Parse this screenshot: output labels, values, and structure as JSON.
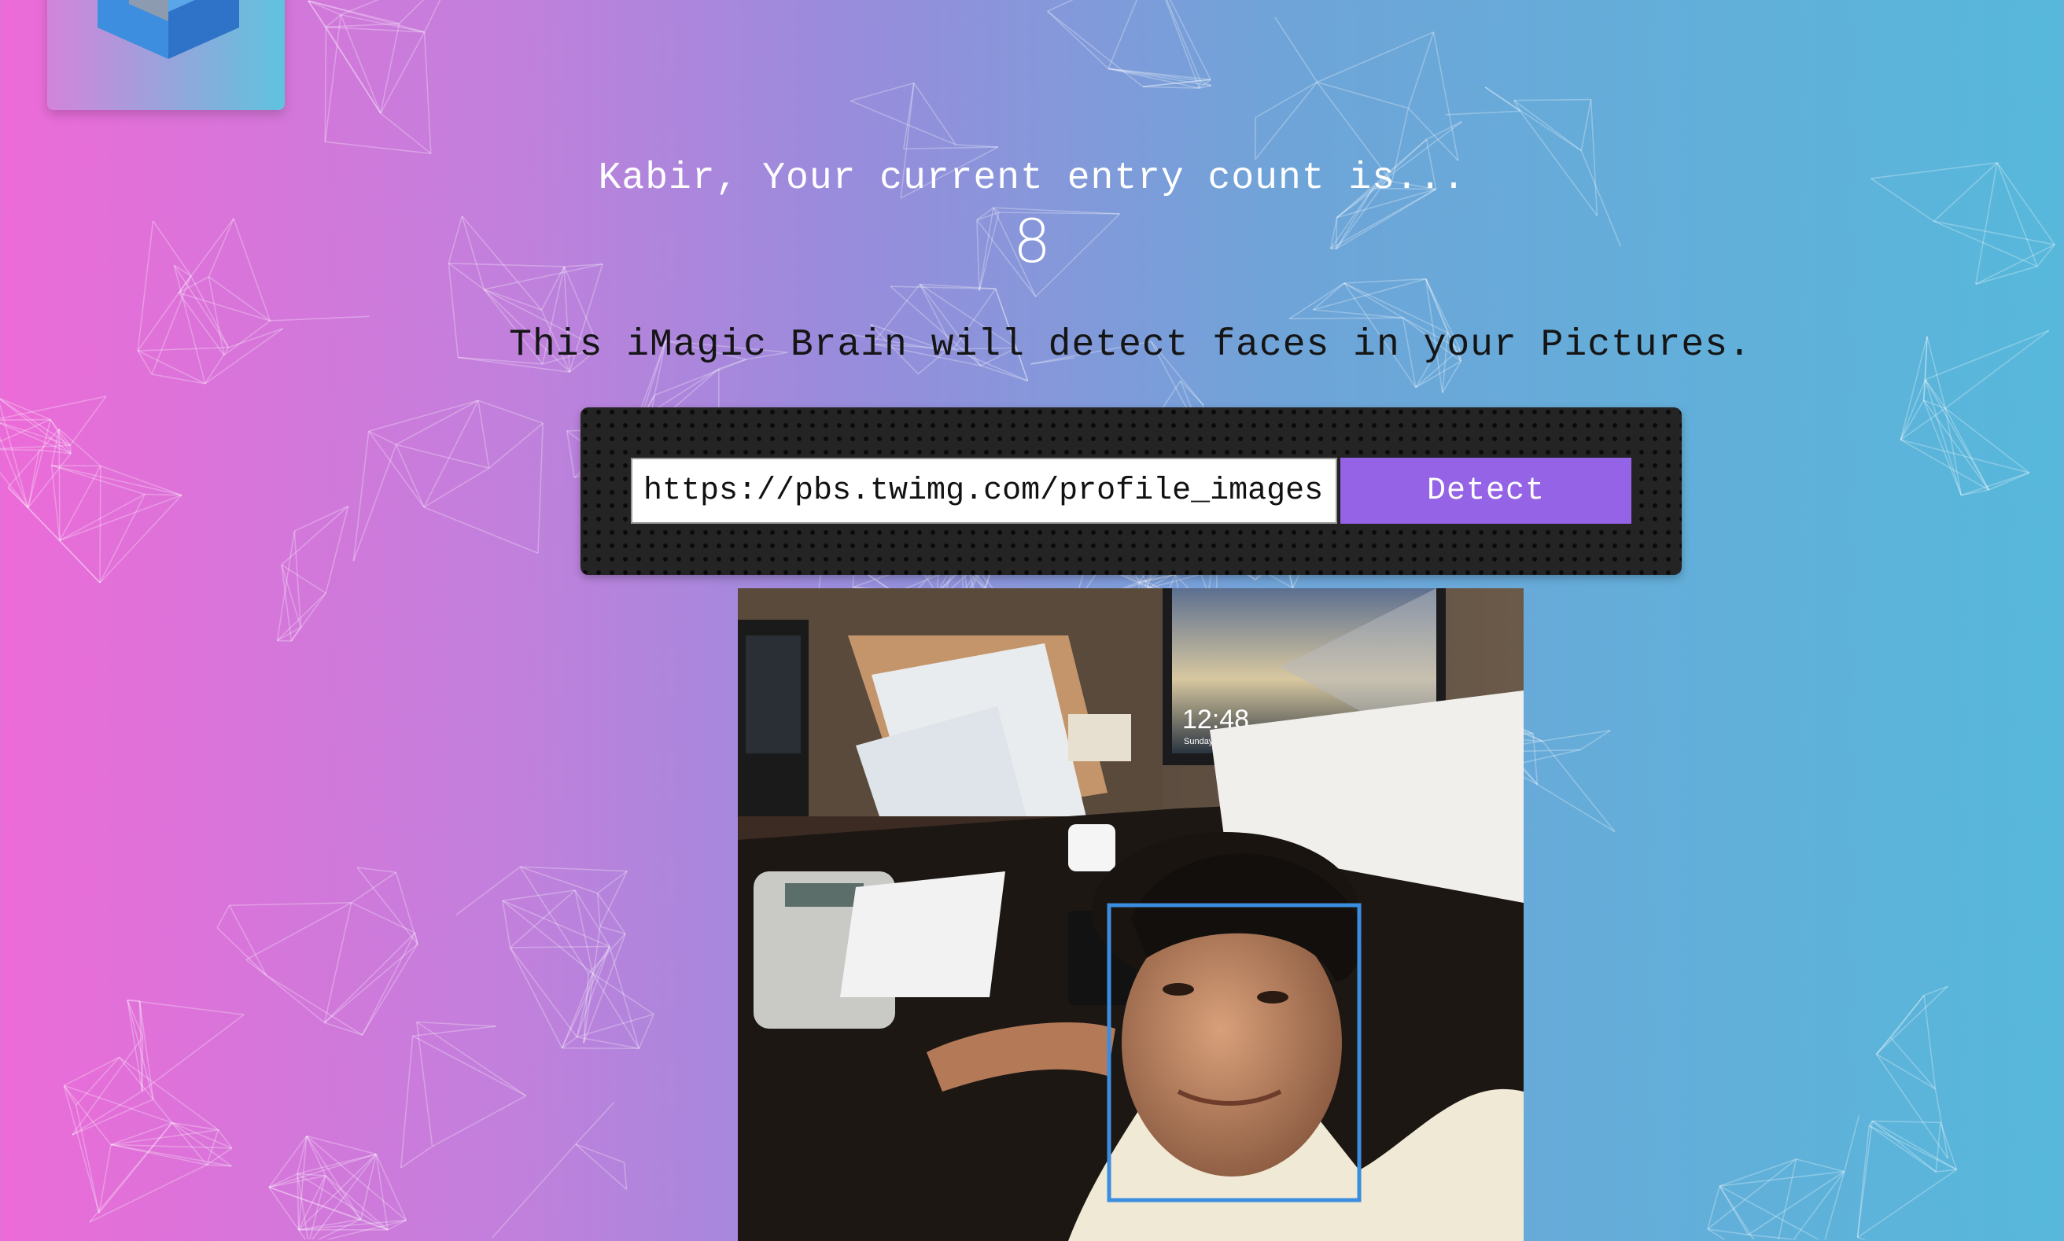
{
  "user": {
    "greeting": "Kabir, Your current entry count is...",
    "entry_count": "8"
  },
  "app": {
    "logo_icon": "cube-logo-icon",
    "tagline": "This iMagic Brain will detect faces in your Pictures."
  },
  "form": {
    "url_value": "https://pbs.twimg.com/profile_images",
    "detect_label": "Detect"
  },
  "image": {
    "clock_time": "12:48",
    "clock_date": "Sunday, April 27"
  },
  "colors": {
    "accent": "#9463e6",
    "face_box": "#3b8de0",
    "gradient_left": "#ec6bd8",
    "gradient_right": "#57b8db"
  }
}
